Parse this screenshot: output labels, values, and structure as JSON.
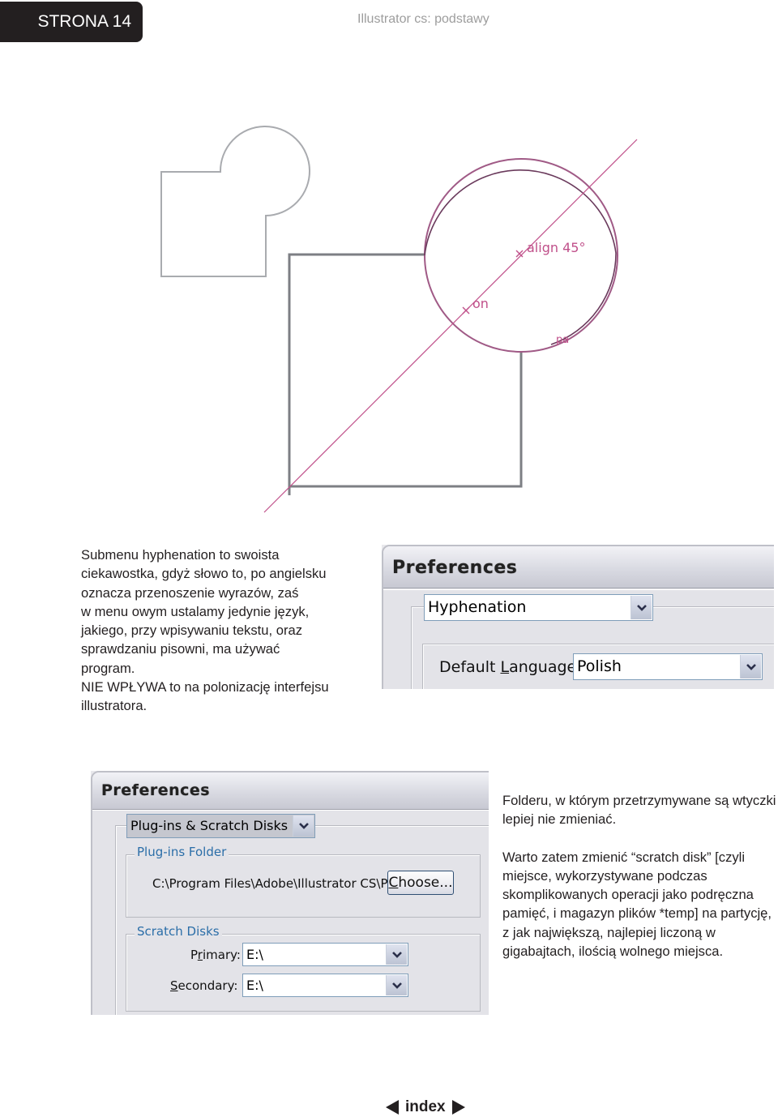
{
  "header": {
    "page_label": "STRONA 14",
    "book_title": "Illustrator cs: podstawy"
  },
  "illustration": {
    "guide_labels": [
      "align 45°",
      "on",
      "pa"
    ],
    "guide_color": "#c0508a",
    "shape_stroke_color": "#7d7f84"
  },
  "left_text": {
    "lines": [
      "Submenu hyphenation to swoista",
      "ciekawostka, gdyż słowo to, po angielsku",
      "oznacza przenoszenie wyrazów, zaś",
      "w menu owym ustalamy jedynie język,",
      "jakiego, przy wpisywaniu  tekstu, oraz",
      "sprawdzaniu pisowni, ma używać",
      "program.",
      "NIE WPŁYWA to na polonizację interfejsu",
      "illustratora."
    ]
  },
  "dialog_hyphenation": {
    "title": "Preferences",
    "category_select": "Hyphenation",
    "default_language_label_pre": "Default ",
    "default_language_label_accel": "L",
    "default_language_label_post": "anguage:",
    "default_language_value": "Polish"
  },
  "dialog_plugins": {
    "title": "Preferences",
    "category_select": "Plug-ins & Scratch Disks",
    "plugins_folder_legend": "Plug-ins Folder",
    "plugins_folder_path": "C:\\Program Files\\Adobe\\Illustrator CS\\Pl...",
    "choose_button_accel": "C",
    "choose_button_rest": "hoose...",
    "scratch_disks_legend": "Scratch Disks",
    "primary_label_pre": "P",
    "primary_label_accel": "r",
    "primary_label_post": "imary:",
    "primary_value": "E:\\",
    "secondary_label_accel": "S",
    "secondary_label_post": "econdary:",
    "secondary_value": "E:\\"
  },
  "right_text": {
    "paragraph1": "Folderu, w którym przetrzymywane są wtyczki lepiej nie zmieniać.",
    "paragraph2": "Warto zatem zmienić “scratch disk” [czyli miejsce, wykorzystywane podczas skomplikowanych operacji jako podręczna pamięć, i magazyn plików *temp] na partycję, z jak największą, najlepiej liczoną w gigabajtach, ilością wolnego miejsca."
  },
  "footer": {
    "prev_icon": "triangle-left-icon",
    "index_label": "index",
    "next_icon": "triangle-right-icon"
  }
}
